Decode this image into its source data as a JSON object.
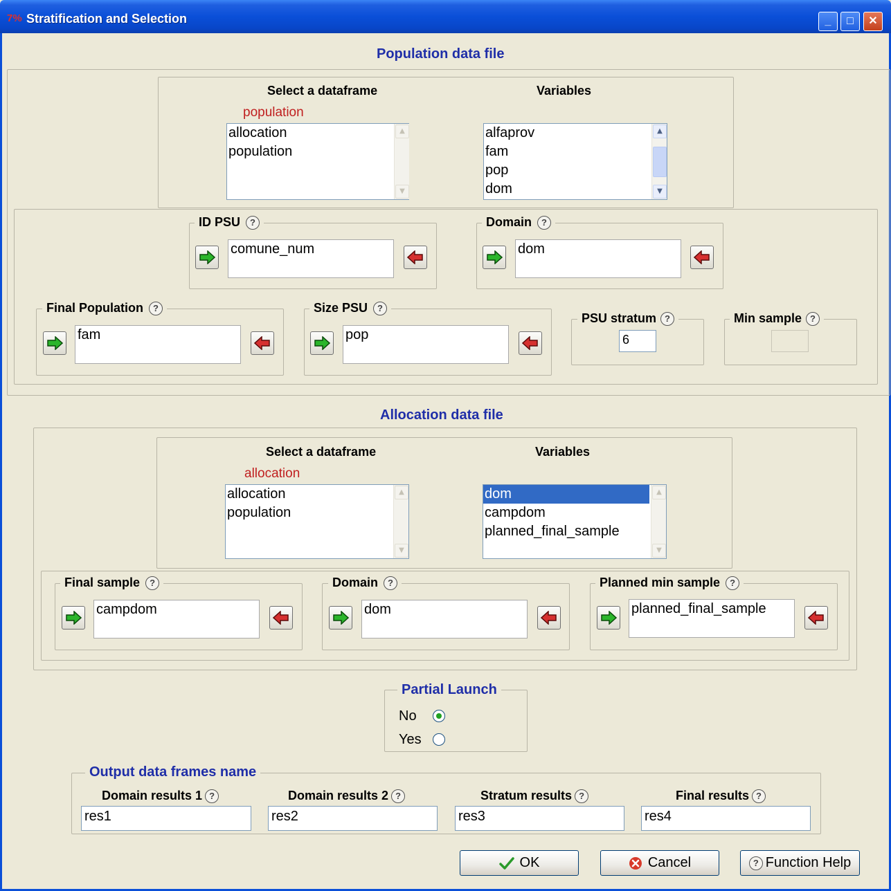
{
  "window": {
    "title": "Stratification and Selection",
    "app_icon_text": "7%",
    "minimize_glyph": "_",
    "maximize_glyph": "□",
    "close_glyph": "✕"
  },
  "population": {
    "section_title": "Population data file",
    "select_label": "Select a dataframe",
    "selected_df": "population",
    "dataframes": [
      "allocation",
      "population"
    ],
    "variables_label": "Variables",
    "variables": [
      "alfaprov",
      "fam",
      "pop",
      "dom"
    ],
    "id_psu": {
      "label": "ID PSU",
      "value": "comune_num"
    },
    "domain": {
      "label": "Domain",
      "value": "dom"
    },
    "final_population": {
      "label": "Final Population",
      "value": "fam"
    },
    "size_psu": {
      "label": "Size PSU",
      "value": "pop"
    },
    "psu_stratum": {
      "label": "PSU stratum",
      "value": "6"
    },
    "min_sample": {
      "label": "Min sample",
      "value": ""
    }
  },
  "allocation": {
    "section_title": "Allocation data file",
    "select_label": "Select a dataframe",
    "selected_df": "allocation",
    "dataframes": [
      "allocation",
      "population"
    ],
    "variables_label": "Variables",
    "variables": [
      "dom",
      "campdom",
      "planned_final_sample"
    ],
    "selected_variable": "dom",
    "final_sample": {
      "label": "Final sample",
      "value": "campdom"
    },
    "domain": {
      "label": "Domain",
      "value": "dom"
    },
    "planned_min_sample": {
      "label": "Planned min sample",
      "value": "planned_final_sample"
    }
  },
  "partial_launch": {
    "title": "Partial Launch",
    "options": [
      "No",
      "Yes"
    ],
    "selected": "No"
  },
  "output": {
    "title": "Output data frames name",
    "fields": [
      {
        "label": "Domain results 1",
        "value": "res1"
      },
      {
        "label": "Domain results 2",
        "value": "res2"
      },
      {
        "label": "Stratum results",
        "value": "res3"
      },
      {
        "label": "Final results",
        "value": "res4"
      }
    ]
  },
  "help_glyph": "?",
  "buttons": {
    "ok": "OK",
    "cancel": "Cancel",
    "help": "Function Help"
  },
  "colors": {
    "section_title": "#1f2ea8",
    "selected_df_label": "#c02020",
    "selection_bg": "#316ac5",
    "titlebar": "#0a4fd8"
  }
}
